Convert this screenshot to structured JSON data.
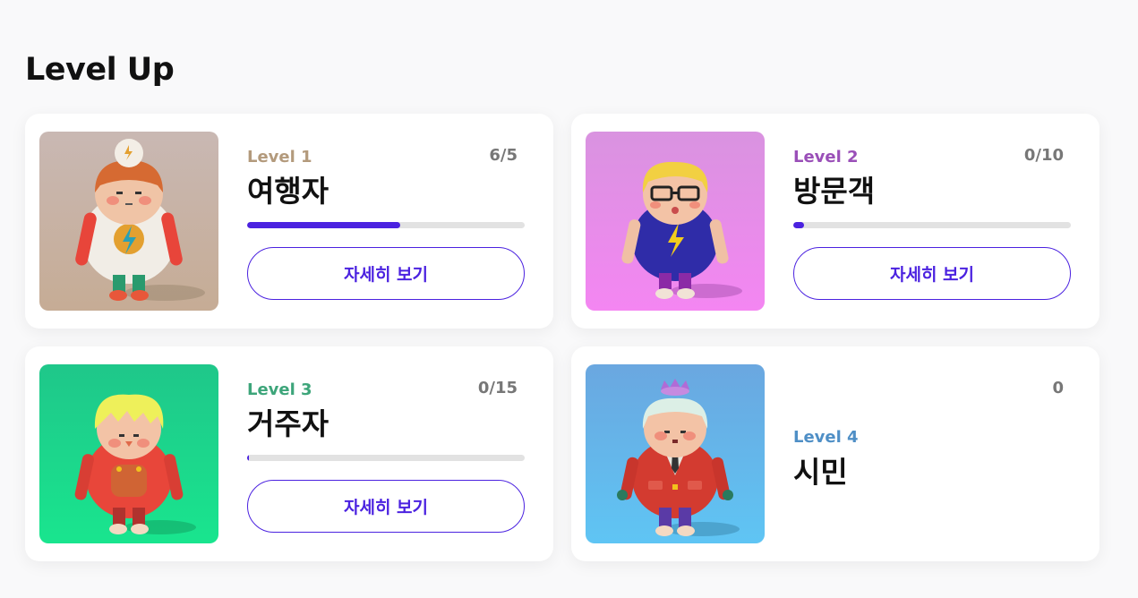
{
  "page": {
    "title": "Level Up"
  },
  "levels": [
    {
      "level_label": "Level 1",
      "name": "여행자",
      "count": "6/5",
      "progress": 0.55,
      "button_label": "자세히 보기",
      "level_color": "#b39a7c",
      "image": "character-traveler"
    },
    {
      "level_label": "Level 2",
      "name": "방문객",
      "count": "0/10",
      "progress": 0.04,
      "button_label": "자세히 보기",
      "level_color": "#9a4fb8",
      "image": "character-visitor"
    },
    {
      "level_label": "Level 3",
      "name": "거주자",
      "count": "0/15",
      "progress": 0.0,
      "button_label": "자세히 보기",
      "level_color": "#3da57a",
      "image": "character-resident"
    },
    {
      "level_label": "Level 4",
      "name": "시민",
      "count": "0",
      "level_color": "#4f8fc6",
      "image": "character-citizen"
    }
  ],
  "colors": {
    "accent": "#4b22e0",
    "track": "#e2e2e2"
  }
}
